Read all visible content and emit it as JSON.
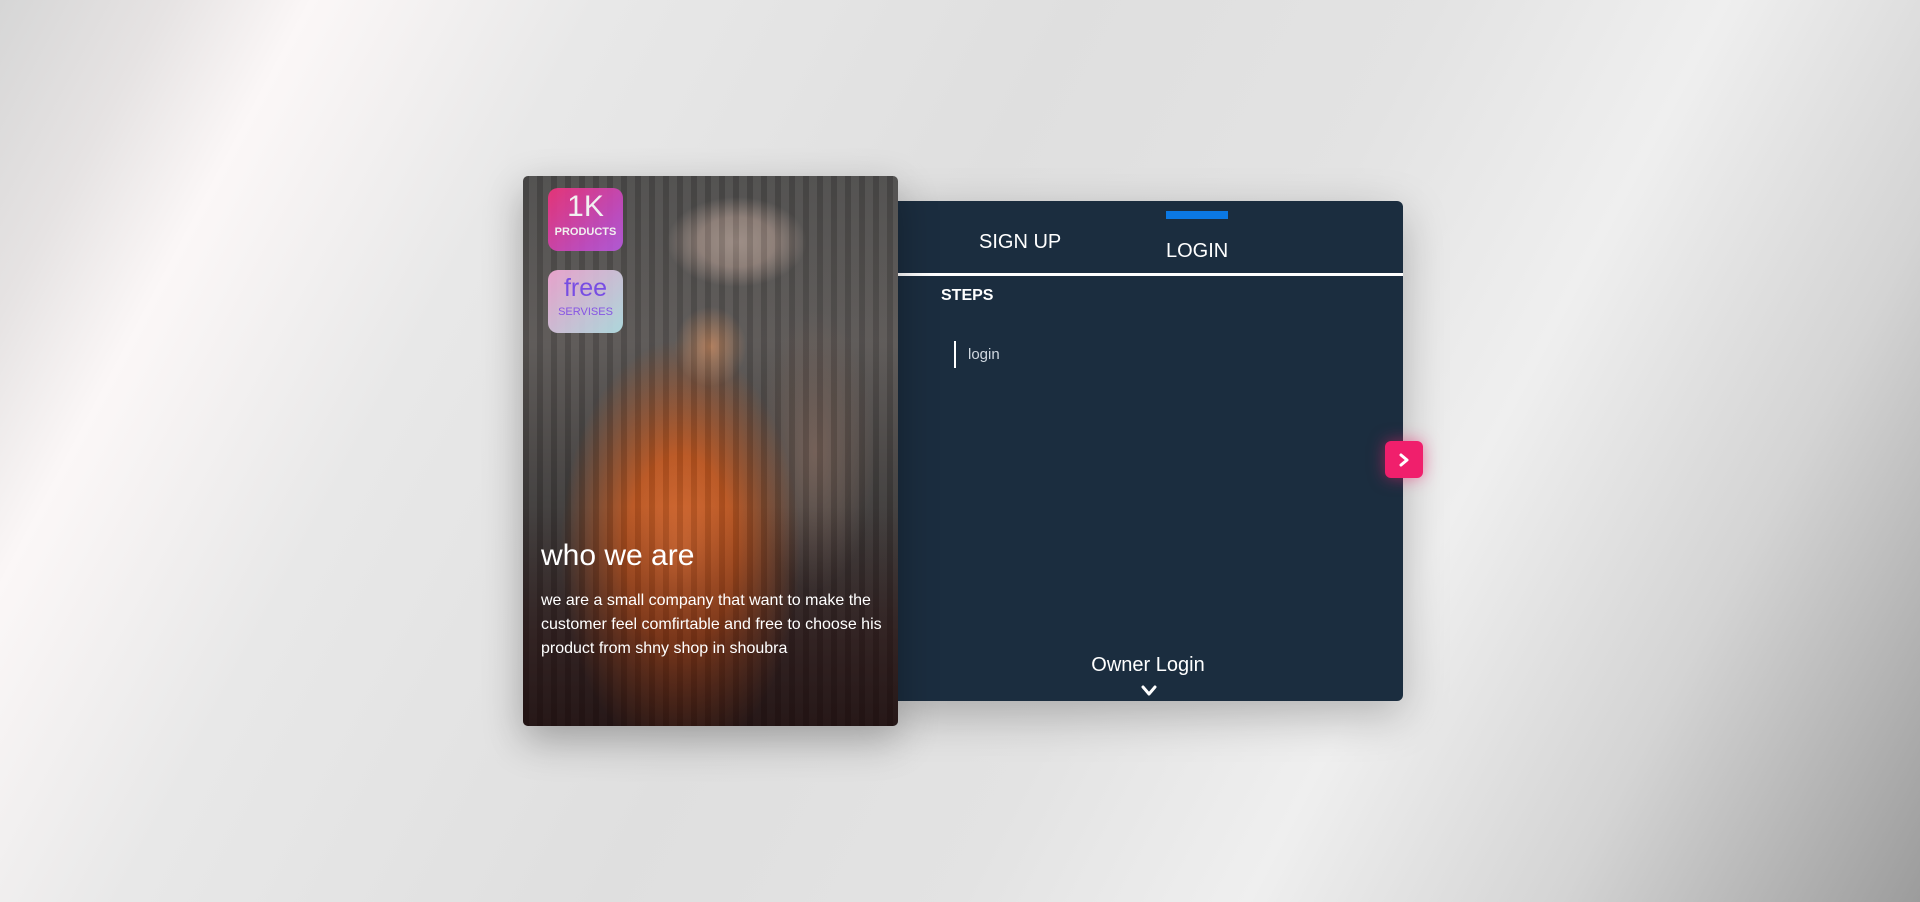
{
  "about": {
    "stats": [
      {
        "value": "1K",
        "label": "PRODUCTS"
      },
      {
        "value": "free",
        "label": "SERVISES"
      }
    ],
    "title": "who we are",
    "text": "we are a small company that want to make the customer feel comfirtable and free to choose his product from shny shop in shoubra"
  },
  "auth": {
    "tabs": [
      {
        "label": "SIGN UP",
        "active": false
      },
      {
        "label": "LOGIN",
        "active": true
      }
    ],
    "steps_heading": "STEPS",
    "steps": [
      "login"
    ],
    "owner_login_label": "Owner Login"
  },
  "icons": {
    "next": "chevron-right-icon",
    "owner_toggle": "chevron-down-icon"
  },
  "colors": {
    "panel_bg": "#1b2d3f",
    "tab_indicator": "#0b78e3",
    "next_button": "#f01f6c"
  }
}
